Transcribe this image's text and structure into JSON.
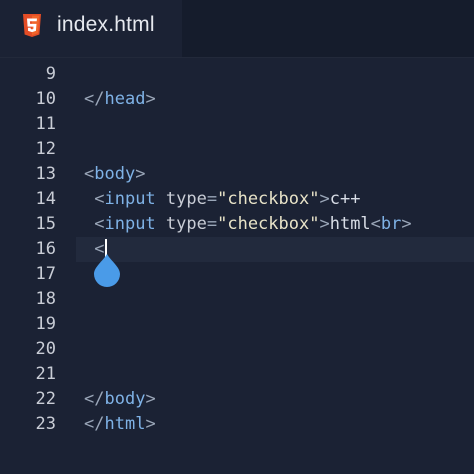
{
  "tab": {
    "filename": "index.html",
    "icon": "html5-icon",
    "icon_color": "#e44d26"
  },
  "editor": {
    "lines": [
      {
        "num": "9",
        "tokens": []
      },
      {
        "num": "10",
        "tokens": [
          {
            "t": "</",
            "c": "punc"
          },
          {
            "t": "head",
            "c": "tag"
          },
          {
            "t": ">",
            "c": "punc"
          }
        ]
      },
      {
        "num": "11",
        "tokens": []
      },
      {
        "num": "12",
        "tokens": []
      },
      {
        "num": "13",
        "tokens": [
          {
            "t": "<",
            "c": "punc"
          },
          {
            "t": "body",
            "c": "tag"
          },
          {
            "t": ">",
            "c": "punc"
          }
        ]
      },
      {
        "num": "14",
        "tokens": [
          {
            "t": " <",
            "c": "punc"
          },
          {
            "t": "input",
            "c": "tag"
          },
          {
            "t": " type",
            "c": "attr"
          },
          {
            "t": "=",
            "c": "punc"
          },
          {
            "t": "\"checkbox\"",
            "c": "str"
          },
          {
            "t": ">",
            "c": "punc"
          },
          {
            "t": "c++",
            "c": "txt"
          }
        ]
      },
      {
        "num": "15",
        "tokens": [
          {
            "t": " <",
            "c": "punc"
          },
          {
            "t": "input",
            "c": "tag"
          },
          {
            "t": " type",
            "c": "attr"
          },
          {
            "t": "=",
            "c": "punc"
          },
          {
            "t": "\"checkbox\"",
            "c": "str"
          },
          {
            "t": ">",
            "c": "punc"
          },
          {
            "t": "html",
            "c": "txt"
          },
          {
            "t": "<",
            "c": "punc"
          },
          {
            "t": "br",
            "c": "tag"
          },
          {
            "t": ">",
            "c": "punc"
          }
        ]
      },
      {
        "num": "16",
        "tokens": [
          {
            "t": " <",
            "c": "punc"
          }
        ],
        "current": true
      },
      {
        "num": "17",
        "tokens": []
      },
      {
        "num": "18",
        "tokens": []
      },
      {
        "num": "19",
        "tokens": []
      },
      {
        "num": "20",
        "tokens": []
      },
      {
        "num": "21",
        "tokens": []
      },
      {
        "num": "22",
        "tokens": [
          {
            "t": "</",
            "c": "punc"
          },
          {
            "t": "body",
            "c": "tag"
          },
          {
            "t": ">",
            "c": "punc"
          }
        ]
      },
      {
        "num": "23",
        "tokens": [
          {
            "t": "</",
            "c": "punc"
          },
          {
            "t": "html",
            "c": "tag"
          },
          {
            "t": ">",
            "c": "punc"
          }
        ]
      }
    ],
    "selection_handle_color": "#4a9be8"
  }
}
